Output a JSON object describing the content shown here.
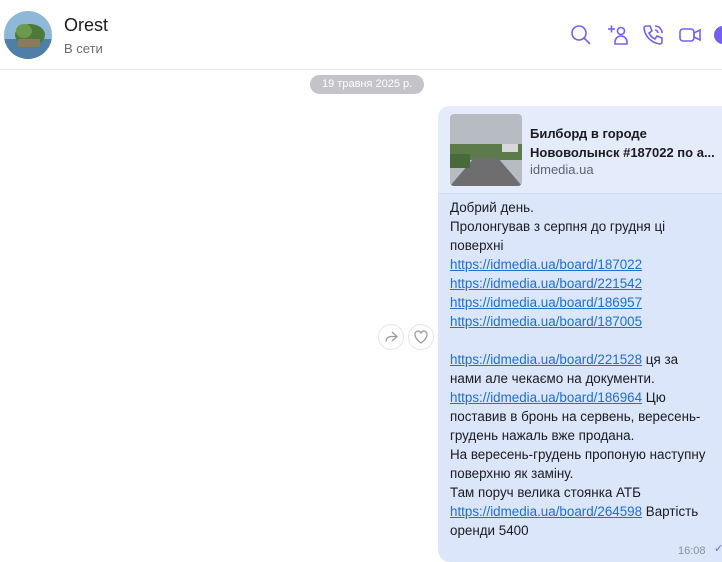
{
  "header": {
    "contact_name": "Orest",
    "status": "В сети"
  },
  "icons": [
    "search-icon",
    "add-contact-icon",
    "call-icon",
    "video-call-icon",
    "more-icon",
    "forward-icon",
    "like-icon"
  ],
  "colors": {
    "accent": "#7360f2",
    "bubble": "#dbe6fb",
    "link": "#1f6fd6",
    "date_pill": "#c3c3c9"
  },
  "chat": {
    "date": "19 травня 2025 р.",
    "message": {
      "preview": {
        "title_line1": "Билборд в городе",
        "title_line2": "Нововолынск #187022 по а...",
        "site": "idmedia.ua"
      },
      "lines": {
        "l1": "Добрий день.",
        "l2": "Пролонгував з серпня до грудня ці",
        "l3": "поверхні",
        "u1": "https://idmedia.ua/board/187022",
        "u2": "https://idmedia.ua/board/221542",
        "u3": "https://idmedia.ua/board/186957",
        "u4": "https://idmedia.ua/board/187005",
        "u5": "https://idmedia.ua/board/221528",
        "u5_suffix": " ця за",
        "l7": "нами але чекаємо на документи.",
        "u6": "https://idmedia.ua/board/186964",
        "u6_suffix": " Цю",
        "l9": "поставив в бронь на сервень, вересень-",
        "l10": "грудень нажаль вже продана.",
        "l11": "На вересень-грудень пропоную наступну",
        "l12": "поверхню  як заміну.",
        "l13": "Там поруч велика стоянка АТБ",
        "u7": "https://idmedia.ua/board/264598",
        "u7_suffix": " Вартість",
        "l15": "оренди  5400"
      },
      "time": "16:08"
    }
  }
}
